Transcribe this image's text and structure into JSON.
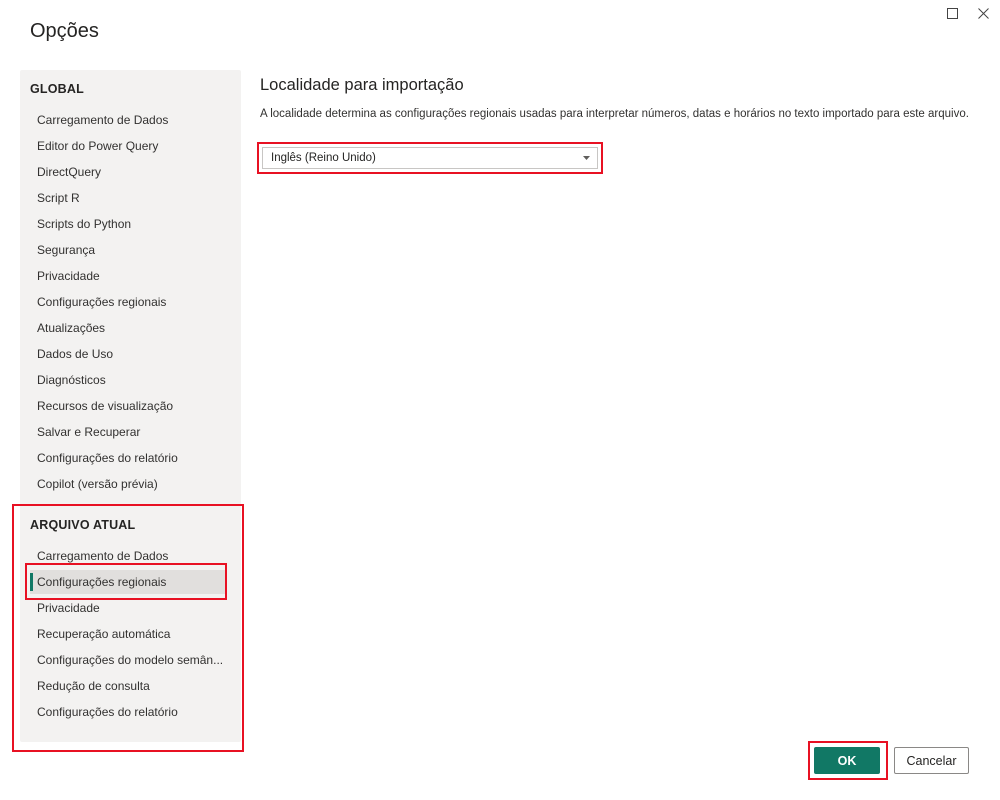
{
  "window": {
    "maximize_icon": "maximize-icon",
    "close_icon": "close-icon"
  },
  "dialog": {
    "title": "Opções"
  },
  "nav": {
    "global_header": "GLOBAL",
    "global_items": [
      "Carregamento de Dados",
      "Editor do Power Query",
      "DirectQuery",
      "Script R",
      "Scripts do Python",
      "Segurança",
      "Privacidade",
      "Configurações regionais",
      "Atualizações",
      "Dados de Uso",
      "Diagnósticos",
      "Recursos de visualização",
      "Salvar e Recuperar",
      "Configurações do relatório",
      "Copilot (versão prévia)"
    ],
    "current_header": "ARQUIVO ATUAL",
    "current_items": [
      "Carregamento de Dados",
      "Configurações regionais",
      "Privacidade",
      "Recuperação automática",
      "Configurações do modelo semân...",
      "Redução de consulta",
      "Configurações do relatório"
    ],
    "selected_item": "Configurações regionais"
  },
  "content": {
    "title": "Localidade para importação",
    "description": "A localidade determina as configurações regionais usadas para interpretar números, datas e horários no texto importado para este arquivo.",
    "locale_select": {
      "value": "Inglês (Reino Unido)",
      "icon": "chevron-down-icon"
    }
  },
  "footer": {
    "ok_label": "OK",
    "cancel_label": "Cancelar"
  },
  "colors": {
    "accent": "#117865",
    "highlight": "#e81123",
    "nav_bg": "#f3f2f1"
  }
}
